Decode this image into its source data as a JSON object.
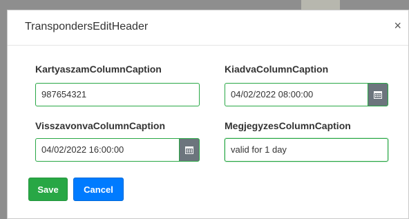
{
  "dialog": {
    "title": "TranspondersEditHeader",
    "close_glyph": "×"
  },
  "fields": {
    "kartyaszam": {
      "label": "KartyaszamColumnCaption",
      "value": "987654321"
    },
    "kiadva": {
      "label": "KiadvaColumnCaption",
      "value": "04/02/2022 08:00:00",
      "icon": "calendar-icon"
    },
    "visszavonva": {
      "label": "VisszavonvaColumnCaption",
      "value": "04/02/2022 16:00:00",
      "icon": "calendar-icon"
    },
    "megjegyzes": {
      "label": "MegjegyzesColumnCaption",
      "value": "valid for 1 day"
    }
  },
  "buttons": {
    "save_label": "Save",
    "cancel_label": "Cancel"
  },
  "colors": {
    "success": "#28a745",
    "primary": "#007bff",
    "calendar_button": "#6c757d"
  }
}
